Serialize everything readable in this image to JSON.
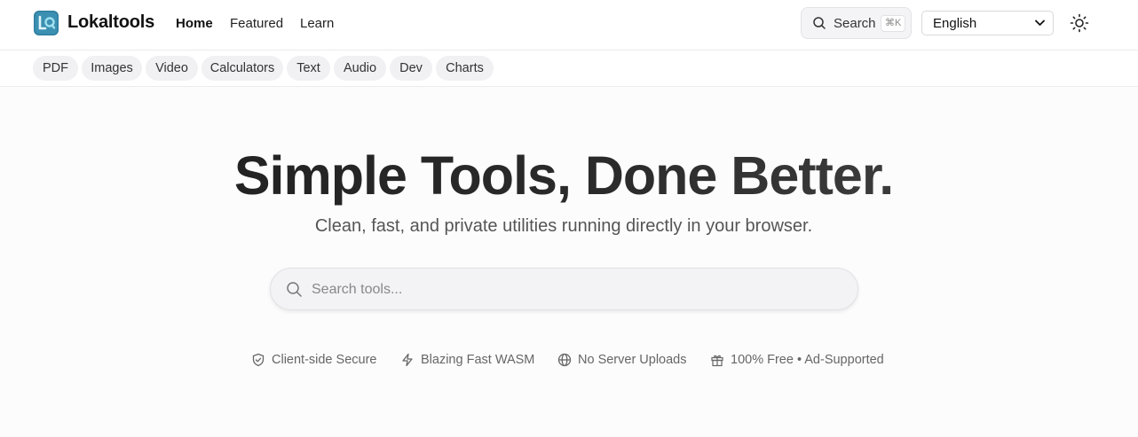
{
  "brand": {
    "name": "Lokaltools",
    "logo_icon": "lokaltools-logo"
  },
  "nav": {
    "items": [
      {
        "label": "Home",
        "active": true
      },
      {
        "label": "Featured"
      },
      {
        "label": "Learn"
      }
    ]
  },
  "header_search": {
    "label": "Search",
    "shortcut": "⌘K",
    "icon": "search-icon"
  },
  "language": {
    "selected": "English"
  },
  "theme_toggle": {
    "icon": "sun-icon"
  },
  "categories": [
    "PDF",
    "Images",
    "Video",
    "Calculators",
    "Text",
    "Audio",
    "Dev",
    "Charts"
  ],
  "hero": {
    "title": "Simple Tools, Done Better.",
    "subtitle": "Clean, fast, and private utilities running directly in your browser.",
    "search_placeholder": "Search tools..."
  },
  "features": [
    {
      "label": "Client-side Secure",
      "icon": "shield-icon"
    },
    {
      "label": "Blazing Fast WASM",
      "icon": "lightning-icon"
    },
    {
      "label": "No Server Uploads",
      "icon": "globe-icon"
    },
    {
      "label": "100% Free • Ad-Supported",
      "icon": "gift-icon"
    }
  ],
  "colors": {
    "logo_bg": "#2f7fa0",
    "logo_accent": "#7fd3e8",
    "text_dark": "#1a1a1a",
    "chip_bg": "#f1f0f3"
  }
}
